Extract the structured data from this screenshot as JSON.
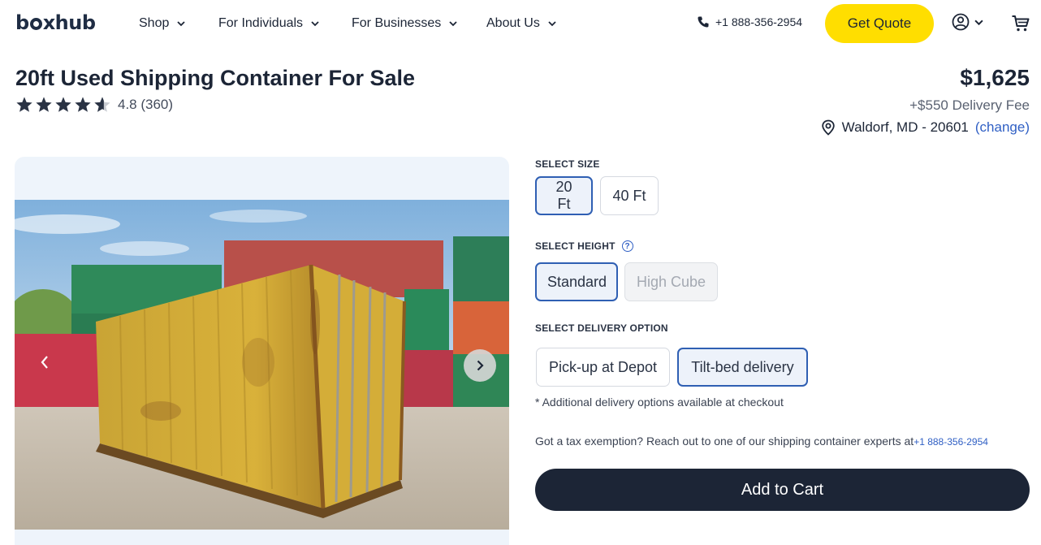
{
  "header": {
    "logo": {
      "pre": "b",
      "post": "xhub"
    },
    "nav": [
      {
        "label": "Shop"
      },
      {
        "label": "For Individuals"
      },
      {
        "label": "For Businesses"
      },
      {
        "label": "About Us"
      }
    ],
    "phone": "+1 888-356-2954",
    "quote_label": "Get Quote",
    "icons": [
      "phone-icon",
      "account-icon",
      "cart-icon",
      "chevron-down-icon"
    ]
  },
  "product": {
    "title": "20ft Used Shipping Container For Sale",
    "rating": {
      "value": 4.8,
      "text": "4.8 (360)",
      "max": 5
    },
    "price": "$1,625",
    "delivery_fee": "+$550 Delivery Fee",
    "location": "Waldorf, MD - 20601",
    "change_label": "(change)"
  },
  "options": {
    "size": {
      "label": "SELECT SIZE",
      "choices": [
        {
          "label": "20 Ft",
          "state": "selected"
        },
        {
          "label": "40 Ft",
          "state": "available"
        }
      ]
    },
    "height": {
      "label": "SELECT HEIGHT",
      "help": "?",
      "choices": [
        {
          "label": "Standard",
          "state": "selected"
        },
        {
          "label": "High Cube",
          "state": "disabled"
        }
      ]
    },
    "delivery": {
      "label": "SELECT DELIVERY OPTION",
      "choices": [
        {
          "label": "Pick-up at Depot",
          "state": "available"
        },
        {
          "label": "Tilt-bed delivery",
          "state": "selected"
        }
      ]
    },
    "note": "* Additional delivery options available at checkout",
    "tax_text": "Got a tax exemption? Reach out to one of our shipping container experts at",
    "tax_phone": "+1 888-356-2954",
    "add_to_cart": "Add to Cart"
  },
  "colors": {
    "brand_dark": "#1c2536",
    "accent_yellow": "#ffde00",
    "link_blue": "#2f5fc4",
    "selected_border": "#2f5fb3"
  }
}
